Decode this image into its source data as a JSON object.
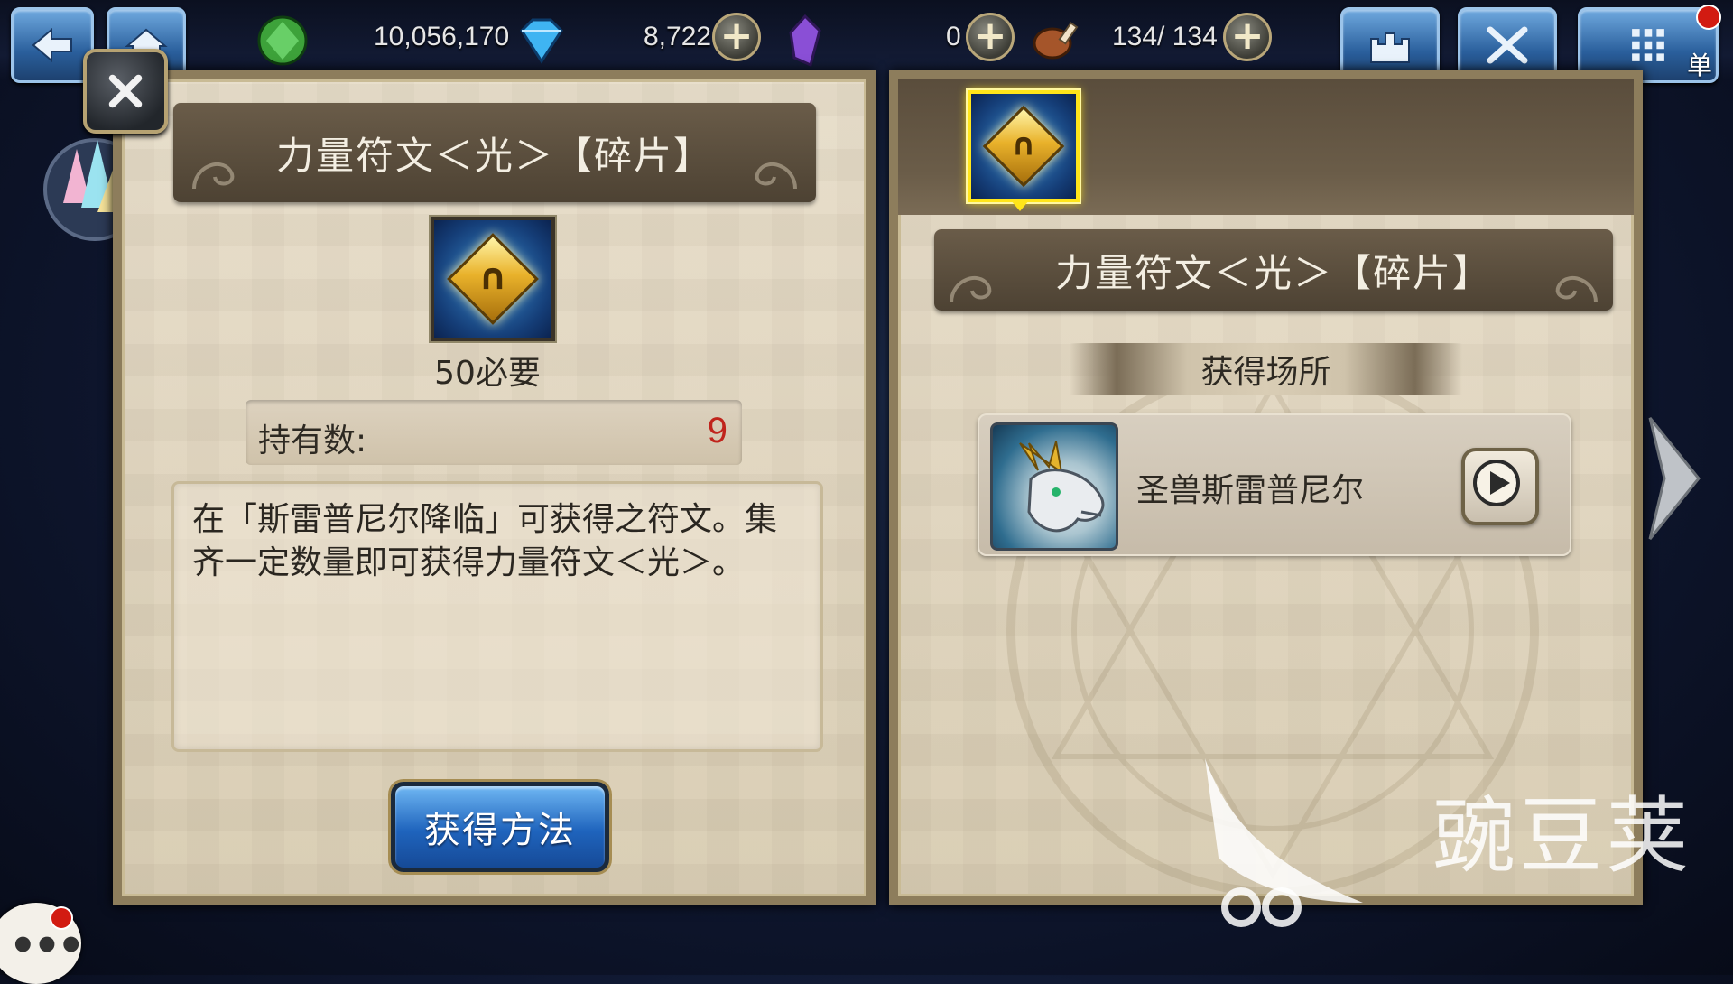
{
  "topbar": {
    "gold_amount": "10,056,170",
    "gem_amount": "8,722",
    "token_amount": "0",
    "stamina": "134/ 134",
    "menu_label": "单"
  },
  "left_panel": {
    "title": "力量符文＜光＞【碎片】",
    "required_text": "50必要",
    "owned_label": "持有数:",
    "owned_value": "9",
    "description_line1": "在「斯雷普尼尔降临」可获得之符文。集",
    "description_line2": "齐一定数量即可获得力量符文＜光＞。",
    "acquire_button": "获得方法"
  },
  "right_panel": {
    "title": "力量符文＜光＞【碎片】",
    "section_heading": "获得场所",
    "source_name": "圣兽斯雷普尼尔"
  },
  "watermark": {
    "text": "豌豆荚"
  },
  "colors": {
    "owned_value": "#c0241c",
    "selected_border": "#ffe51a",
    "blue_button": "#1f64bd"
  }
}
